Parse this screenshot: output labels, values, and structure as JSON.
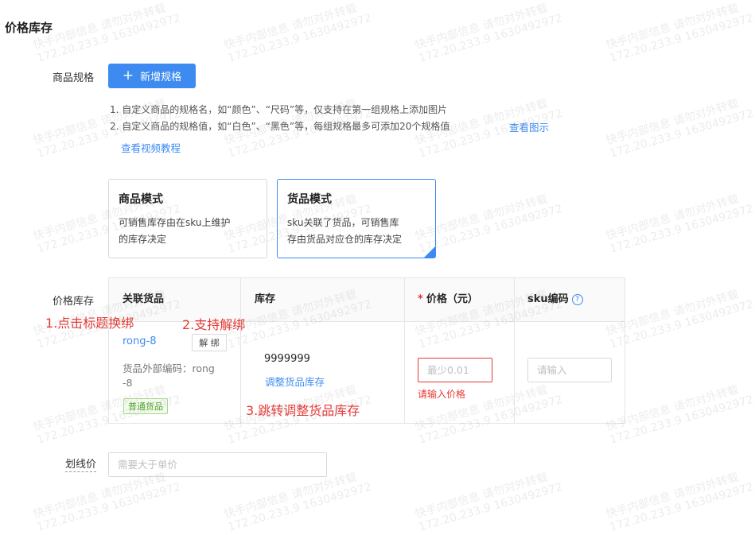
{
  "section_title": "价格库存",
  "spec": {
    "label": "商品规格",
    "add_button": "新增规格",
    "tips": [
      "1. 自定义商品的规格名，如“颜色”、“尺码”等，仅支持在第一组规格上添加图片",
      "2. 自定义商品的规格值，如“白色”、“黑色”等，每组规格最多可添加20个规格值"
    ],
    "view_image_link": "查看图示",
    "view_video_link": "查看视频教程"
  },
  "modes": [
    {
      "title": "商品模式",
      "desc_lines": [
        "可销售库存由在sku上维护",
        "的库存决定"
      ],
      "selected": false
    },
    {
      "title": "货品模式",
      "desc_lines": [
        "sku关联了货品，可销售库",
        "存由货品对应仓的库存决定"
      ],
      "selected": true
    }
  ],
  "price_stock": {
    "label": "价格库存",
    "columns": {
      "goods": "关联货品",
      "stock": "库存",
      "price_required_mark": "*",
      "price": "价格（元）",
      "sku_code": "sku编码",
      "help_icon": "?"
    },
    "row": {
      "goods_name": "rong-8",
      "unbind_button": "解 绑",
      "external_code_label": "货品外部编码：rong",
      "external_code_suffix": "-8",
      "goods_tag": "普通货品",
      "stock_value": "9999999",
      "adjust_stock_link": "调整货品库存",
      "price_placeholder": "最少0.01",
      "price_error": "请输入价格",
      "sku_placeholder": "请输入"
    }
  },
  "strike_price": {
    "label": "划线价",
    "placeholder": "需要大于单价"
  },
  "annotations": [
    "1.点击标题换绑",
    "2.支持解绑",
    "3.跳转调整货品库存"
  ],
  "watermark": {
    "line1": "快手内部信息 请勿对外转载",
    "line2": "172.20.233.9 1630492972"
  },
  "colors": {
    "primary": "#3d8bf0",
    "error": "#e53935",
    "tag_green": "#52a52e"
  }
}
